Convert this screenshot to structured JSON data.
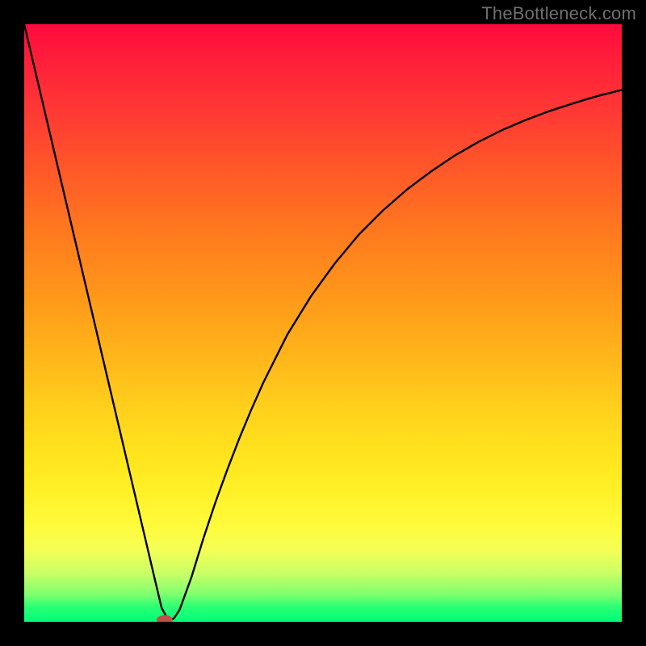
{
  "watermark": "TheBottleneck.com",
  "chart_data": {
    "type": "line",
    "title": "",
    "xlabel": "",
    "ylabel": "",
    "xlim": [
      0,
      100
    ],
    "ylim": [
      0,
      100
    ],
    "series": [
      {
        "name": "curve",
        "x": [
          0,
          2,
          4,
          6,
          8,
          10,
          12,
          14,
          16,
          18,
          20,
          22,
          23,
          24,
          25,
          26,
          28,
          30,
          32,
          34,
          36,
          38,
          40,
          44,
          48,
          52,
          56,
          60,
          64,
          68,
          72,
          76,
          80,
          84,
          88,
          92,
          96,
          100
        ],
        "y": [
          100,
          91.5,
          83.0,
          74.5,
          66.0,
          57.5,
          49.0,
          40.5,
          32.0,
          23.5,
          15.0,
          6.5,
          2.3,
          0.5,
          0.5,
          2.0,
          7.5,
          14.0,
          20.0,
          25.5,
          30.7,
          35.5,
          40.0,
          48.0,
          54.5,
          60.0,
          64.8,
          68.8,
          72.3,
          75.3,
          78.0,
          80.3,
          82.3,
          84.0,
          85.5,
          86.8,
          88.0,
          89.0
        ]
      }
    ],
    "marker": {
      "x": 23.5,
      "y": 0.3,
      "color": "#c05048"
    },
    "background": "red-yellow-green vertical gradient"
  }
}
